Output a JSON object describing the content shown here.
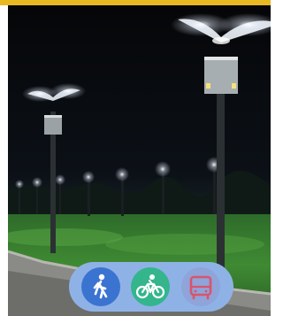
{
  "scene": {
    "subject": "streetlights-at-night",
    "accent_yellow": "#e8b923"
  },
  "transport_modes": [
    {
      "name": "walk",
      "icon": "walk-icon",
      "color": "#3b73d1",
      "state": "active"
    },
    {
      "name": "bike",
      "icon": "bike-icon",
      "color": "#34b58c",
      "state": "active"
    },
    {
      "name": "bus",
      "icon": "bus-icon",
      "color": "#d9546d",
      "state": "inactive"
    }
  ],
  "mode_bar_color": "#8fb2e6"
}
